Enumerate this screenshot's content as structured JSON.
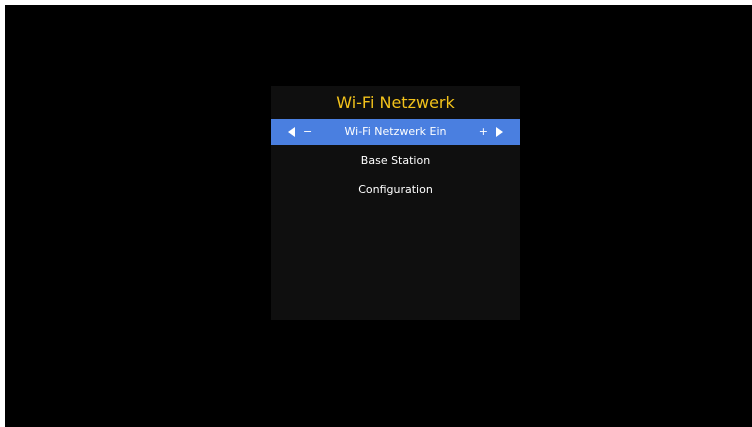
{
  "colors": {
    "background": "#000000",
    "panel": "#0f0f0f",
    "title": "#f2c21b",
    "selected": "#4a7fe0",
    "text": "#ffffff"
  },
  "menu": {
    "title": "Wi-Fi Netzwerk",
    "items": [
      {
        "label": "Wi-Fi Netzwerk Ein",
        "selected": true,
        "decrease_label": "−",
        "increase_label": "+",
        "left_icon": "arrow-left-icon",
        "right_icon": "arrow-right-icon"
      },
      {
        "label": "Base Station",
        "selected": false
      },
      {
        "label": "Configuration",
        "selected": false
      }
    ]
  }
}
